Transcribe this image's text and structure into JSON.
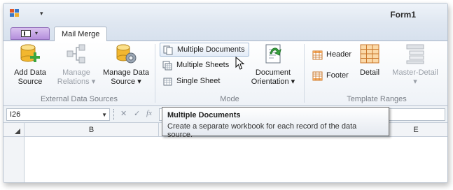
{
  "window": {
    "title": "Form1"
  },
  "qat": {
    "customize_glyph": "▾"
  },
  "app_button": {
    "dropdown_glyph": "▾"
  },
  "tabs": [
    {
      "label": "Mail Merge"
    }
  ],
  "ribbon": {
    "groups": [
      {
        "label": "External Data Sources",
        "items": [
          {
            "label_line1": "Add Data",
            "label_line2": "Source",
            "icon": "add-data-source-icon",
            "enabled": true
          },
          {
            "label_line1": "Manage",
            "label_line2": "Relations ▾",
            "icon": "manage-relations-icon",
            "enabled": false
          },
          {
            "label_line1": "Manage Data",
            "label_line2": "Source ▾",
            "icon": "manage-data-source-icon",
            "enabled": true
          }
        ]
      },
      {
        "label": "Mode",
        "items": [
          {
            "label": "Multiple Documents",
            "icon": "multiple-documents-icon",
            "active": true
          },
          {
            "label": "Multiple Sheets",
            "icon": "multiple-sheets-icon",
            "active": false
          },
          {
            "label": "Single Sheet",
            "icon": "single-sheet-icon",
            "active": false
          },
          {
            "label_line1": "Document",
            "label_line2": "Orientation ▾",
            "icon": "document-orientation-icon"
          }
        ]
      },
      {
        "label": "Template Ranges",
        "items": [
          {
            "label": "Header",
            "icon": "header-icon"
          },
          {
            "label": "Footer",
            "icon": "footer-icon"
          },
          {
            "label": "Detail",
            "icon": "detail-icon",
            "enabled": true
          },
          {
            "label_line1": "Master-Detail",
            "label_line2": "▾",
            "icon": "master-detail-icon",
            "enabled": false
          }
        ]
      }
    ]
  },
  "formula_bar": {
    "name_box": "I26",
    "cancel_glyph": "✕",
    "enter_glyph": "✓",
    "function_glyph": "fx"
  },
  "grid": {
    "columns": [
      "B",
      "E"
    ]
  },
  "tooltip": {
    "title": "Multiple Documents",
    "body": "Create a separate workbook for each record of the data source."
  },
  "colors": {
    "accent_tab": "#b58fdc",
    "ribbon_bg": "#eef2f7",
    "tooltip_border": "#767676"
  }
}
